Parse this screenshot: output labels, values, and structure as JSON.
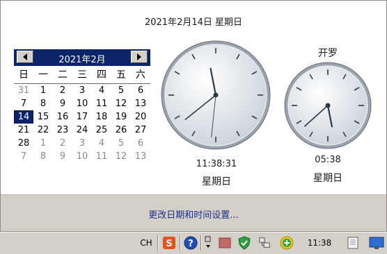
{
  "header": {
    "date_text": "2021年2月14日 星期日"
  },
  "calendar": {
    "title": "2021年2月",
    "weekdays": [
      "日",
      "一",
      "二",
      "三",
      "四",
      "五",
      "六"
    ],
    "weeks": [
      [
        "31",
        "1",
        "2",
        "3",
        "4",
        "5",
        "6"
      ],
      [
        "7",
        "8",
        "9",
        "10",
        "11",
        "12",
        "13"
      ],
      [
        "14",
        "15",
        "16",
        "17",
        "18",
        "19",
        "20"
      ],
      [
        "21",
        "22",
        "23",
        "24",
        "25",
        "26",
        "27"
      ],
      [
        "28",
        "1",
        "2",
        "3",
        "4",
        "5",
        "6"
      ],
      [
        "7",
        "8",
        "9",
        "10",
        "11",
        "12",
        "13"
      ]
    ],
    "muted": [
      [
        true,
        false,
        false,
        false,
        false,
        false,
        false
      ],
      [
        false,
        false,
        false,
        false,
        false,
        false,
        false
      ],
      [
        false,
        false,
        false,
        false,
        false,
        false,
        false
      ],
      [
        false,
        false,
        false,
        false,
        false,
        false,
        false
      ],
      [
        false,
        true,
        true,
        true,
        true,
        true,
        true
      ],
      [
        true,
        true,
        true,
        true,
        true,
        true,
        true
      ]
    ],
    "selected_day": "14"
  },
  "clock1": {
    "time": "11:38:31",
    "day": "星期日",
    "hour": 11,
    "minute": 38,
    "second": 31
  },
  "clock2": {
    "city": "开罗",
    "time": "05:38",
    "day": "星期日",
    "hour": 5,
    "minute": 38
  },
  "footer": {
    "settings_link": "更改日期和时间设置..."
  },
  "taskbar": {
    "language": "CH",
    "clock": "11:38"
  },
  "icons": {
    "prev": "triangle-left-icon",
    "next": "triangle-right-icon",
    "sogou": "sogou-input-icon",
    "help": "help-icon",
    "shield": "shield-icon",
    "network": "network-icon",
    "green": "green-plus-icon",
    "desktop": "show-desktop-icon",
    "monitor": "monitor-icon"
  },
  "colors": {
    "calendar_header": "#0a246a",
    "link": "#1a2f8c"
  }
}
